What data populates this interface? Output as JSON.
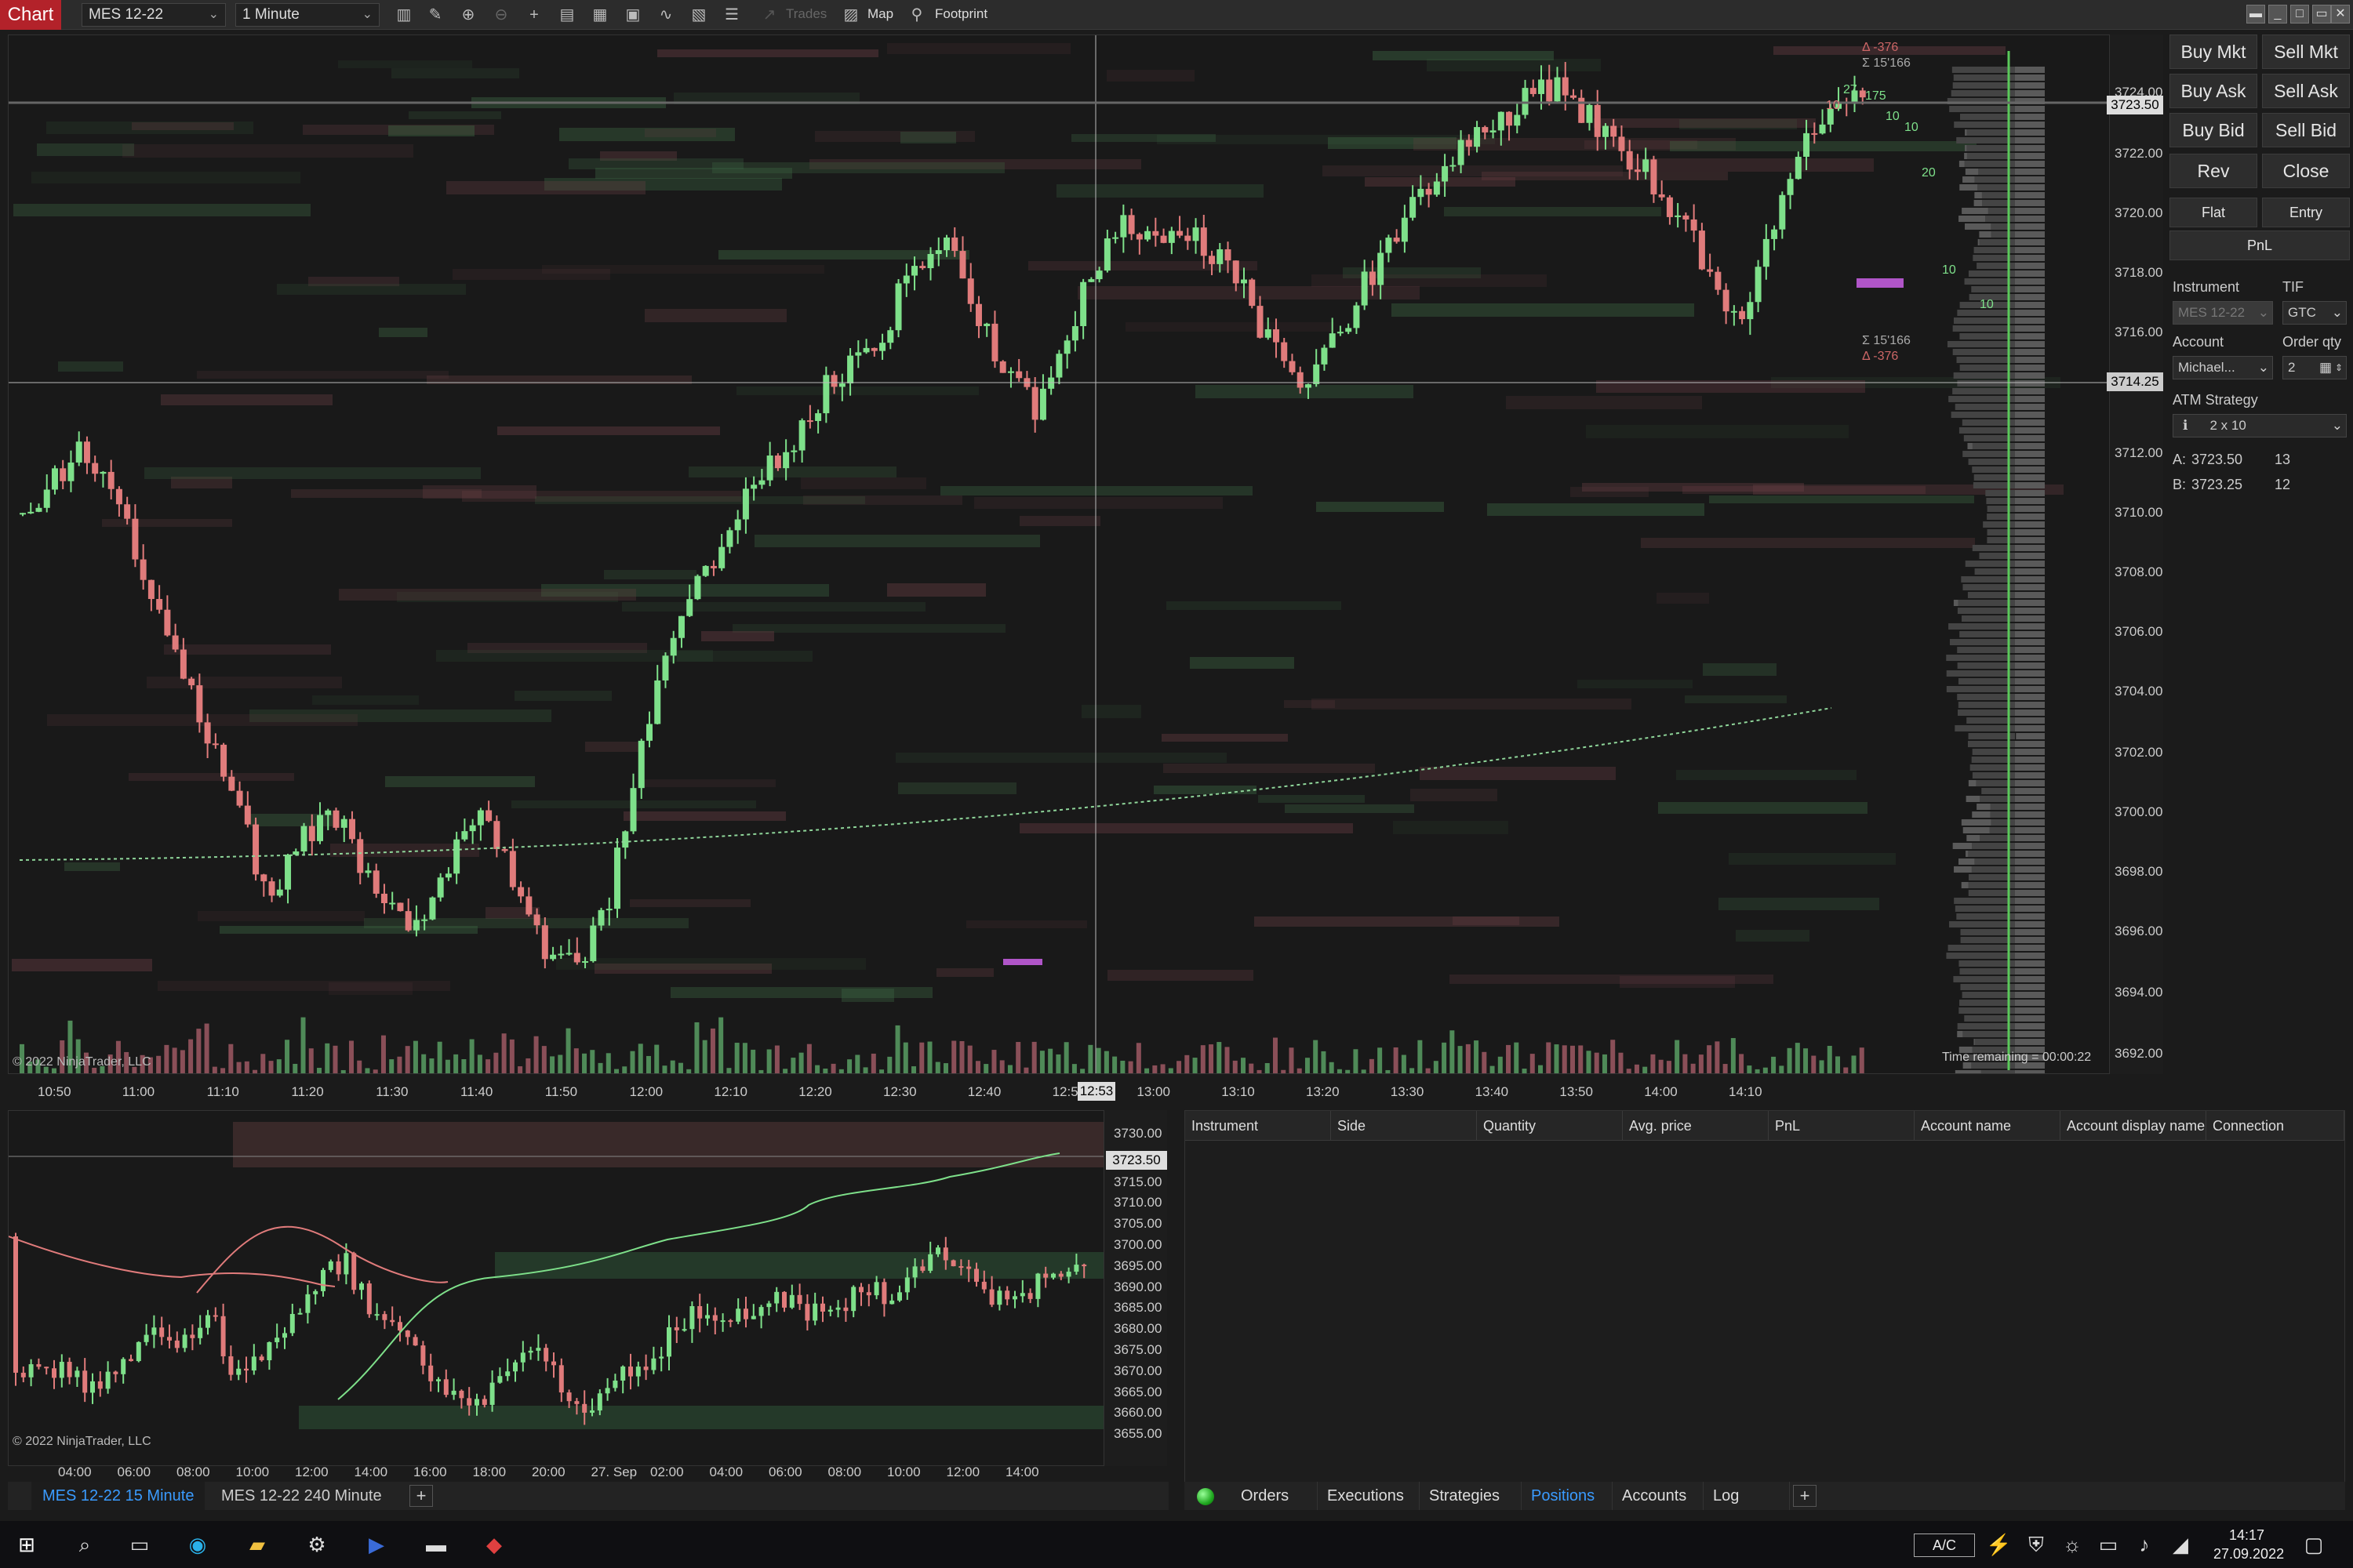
{
  "toolbar": {
    "badge": "Chart",
    "instrument": "MES 12-22",
    "interval": "1 Minute",
    "trades_label": "Trades",
    "map_label": "Map",
    "footprint_label": "Footprint"
  },
  "main_chart": {
    "y_labels": [
      "3724.00",
      "3722.00",
      "3720.00",
      "3718.00",
      "3716.00",
      "3712.00",
      "3710.00",
      "3708.00",
      "3706.00",
      "3704.00",
      "3702.00",
      "3700.00",
      "3698.00",
      "3696.00",
      "3694.00",
      "3692.00"
    ],
    "x_labels": [
      "10:50",
      "11:00",
      "11:10",
      "11:20",
      "11:30",
      "11:40",
      "11:50",
      "12:00",
      "12:10",
      "12:20",
      "12:30",
      "12:40",
      "12:5",
      "13:00",
      "13:10",
      "13:20",
      "13:30",
      "13:40",
      "13:50",
      "14:00",
      "14:10"
    ],
    "crosshair_time": "12:53",
    "last_price": "3723.50",
    "crosshair_price": "3714.25",
    "copyright": "© 2022 NinjaTrader, LLC",
    "time_remaining": "Time remaining = 00:00:22",
    "delta_top": "Δ -376",
    "sigma_top": "Σ 15'166",
    "delta_bottom": "Δ -376",
    "sigma_bottom": "Σ 15'166",
    "footprint_numbers": [
      "27",
      "175",
      "10",
      "10",
      "10",
      "20",
      "10",
      "10"
    ]
  },
  "trade_panel": {
    "buy_mkt": "Buy Mkt",
    "sell_mkt": "Sell Mkt",
    "buy_ask": "Buy Ask",
    "sell_ask": "Sell Ask",
    "buy_bid": "Buy Bid",
    "sell_bid": "Sell Bid",
    "rev": "Rev",
    "close": "Close",
    "flat": "Flat",
    "entry": "Entry",
    "pnl": "PnL",
    "instrument_label": "Instrument",
    "instrument_value": "MES 12-22",
    "tif_label": "TIF",
    "tif_value": "GTC",
    "account_label": "Account",
    "account_value": "Michael...",
    "order_qty_label": "Order qty",
    "order_qty_value": "2",
    "atm_label": "ATM Strategy",
    "atm_value": "2 x 10",
    "ask_label": "A:",
    "ask_price": "3723.50",
    "ask_size": "13",
    "bid_label": "B:",
    "bid_price": "3723.25",
    "bid_size": "12"
  },
  "sub_chart": {
    "y_labels": [
      "3730.00",
      "3720.00",
      "3715.00",
      "3710.00",
      "3705.00",
      "3700.00",
      "3695.00",
      "3690.00",
      "3685.00",
      "3680.00",
      "3675.00",
      "3670.00",
      "3665.00",
      "3660.00",
      "3655.00"
    ],
    "last_price": "3723.50",
    "x_labels": [
      "04:00",
      "06:00",
      "08:00",
      "10:00",
      "12:00",
      "14:00",
      "16:00",
      "18:00",
      "20:00",
      "27. Sep",
      "02:00",
      "04:00",
      "06:00",
      "08:00",
      "10:00",
      "12:00",
      "14:00"
    ],
    "copyright": "© 2022 NinjaTrader, LLC",
    "tabs": [
      "MES 12-22 15 Minute",
      "MES 12-22 240 Minute"
    ],
    "add": "+"
  },
  "positions": {
    "columns": [
      "Instrument",
      "Side",
      "Quantity",
      "Avg. price",
      "PnL",
      "Account name",
      "Account display name",
      "Connection"
    ],
    "tabs": [
      "Orders",
      "Executions",
      "Strategies",
      "Positions",
      "Accounts",
      "Log"
    ],
    "active_tab": "Positions",
    "add": "+"
  },
  "taskbar": {
    "keyboard": "A/C",
    "time": "14:17",
    "date": "27.09.2022"
  },
  "colors": {
    "bull": "#7ee08a",
    "bear": "#e07b7b",
    "accent": "#3a9bff",
    "badge": "#b3222a"
  }
}
